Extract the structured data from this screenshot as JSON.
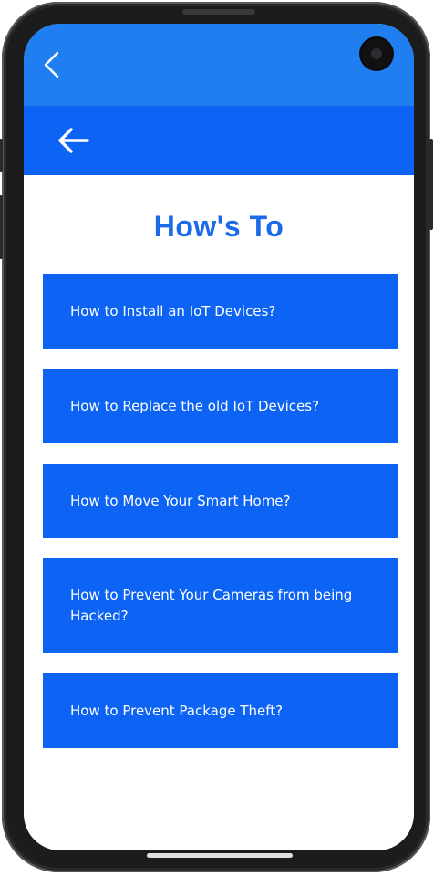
{
  "status_bar": {
    "back_icon": "chevron-left-icon",
    "camera_icon": "front-camera-icon",
    "color": "#1f7ef0"
  },
  "header": {
    "back_icon": "arrow-left-icon",
    "color": "#0d63f3"
  },
  "page": {
    "title": "How's To",
    "title_color": "#1b6be8"
  },
  "howto_items": [
    {
      "label": "How to Install an IoT Devices?"
    },
    {
      "label": "How to Replace the old IoT Devices?"
    },
    {
      "label": "How to Move Your Smart Home?"
    },
    {
      "label": "How to Prevent Your Cameras from being Hacked?"
    },
    {
      "label": "How to Prevent Package Theft?"
    }
  ],
  "colors": {
    "item_background": "#0d63f3",
    "item_text": "#ffffff"
  }
}
